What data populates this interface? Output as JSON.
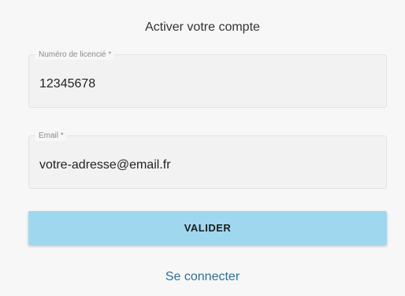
{
  "form": {
    "title": "Activer votre compte",
    "license_field": {
      "label": "Numéro de licencié *",
      "value": "12345678"
    },
    "email_field": {
      "label": "Email *",
      "value": "votre-adresse@email.fr"
    },
    "submit_label": "VALIDER",
    "login_link": "Se connecter"
  },
  "colors": {
    "button_bg": "#9fd8ee",
    "link": "#2f6f95",
    "background": "#f7f7f7"
  }
}
